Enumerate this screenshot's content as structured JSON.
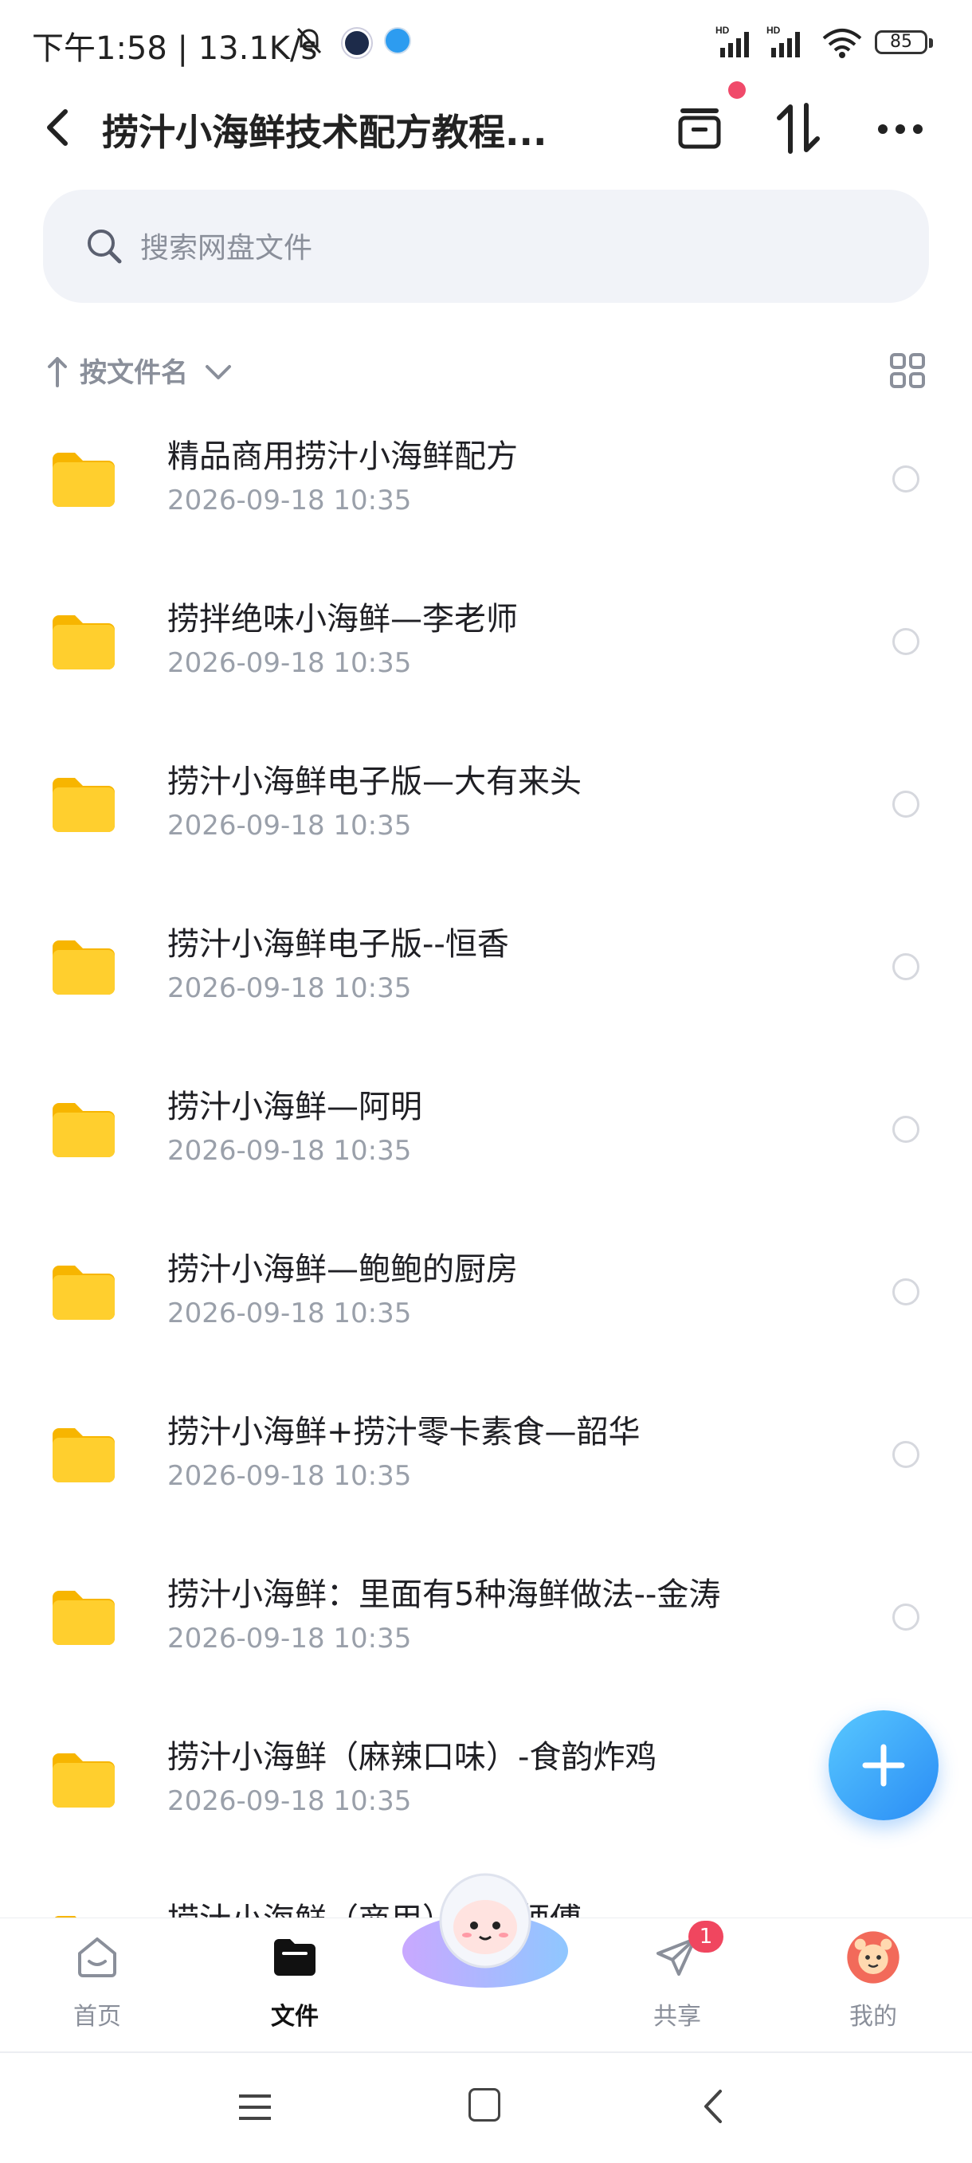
{
  "status_bar": {
    "time": "下午1:58 | 13.1K/s",
    "battery": "85"
  },
  "header": {
    "title": "捞汁小海鲜技术配方教程..."
  },
  "search": {
    "placeholder": "搜索网盘文件"
  },
  "sort": {
    "label": "按文件名"
  },
  "files": [
    {
      "name": "精品商用捞汁小海鲜配方",
      "date": "2026-09-18  10:35"
    },
    {
      "name": "捞拌绝味小海鲜—李老师",
      "date": "2026-09-18  10:35"
    },
    {
      "name": "捞汁小海鲜电子版—大有来头",
      "date": "2026-09-18  10:35"
    },
    {
      "name": "捞汁小海鲜电子版--恒香",
      "date": "2026-09-18  10:35"
    },
    {
      "name": "捞汁小海鲜—阿明",
      "date": "2026-09-18  10:35"
    },
    {
      "name": "捞汁小海鲜—鲍鲍的厨房",
      "date": "2026-09-18  10:35"
    },
    {
      "name": "捞汁小海鲜+捞汁零卡素食—韶华",
      "date": "2026-09-18  10:35"
    },
    {
      "name": "捞汁小海鲜：里面有5种海鲜做法--金涛",
      "date": "2026-09-18  10:35"
    },
    {
      "name": "捞汁小海鲜（麻辣口味）-食韵炸鸡",
      "date": "2026-09-18  10:35"
    },
    {
      "name": "捞汁小海鲜（商用）—草师傅",
      "date": ""
    }
  ],
  "bottom_nav": {
    "home": "首页",
    "files": "文件",
    "share": "共享",
    "share_badge": "1",
    "mine": "我的"
  },
  "colors": {
    "accent": "#2a8cf5",
    "folder": "#ffcf2e",
    "badge": "#f0465f"
  }
}
